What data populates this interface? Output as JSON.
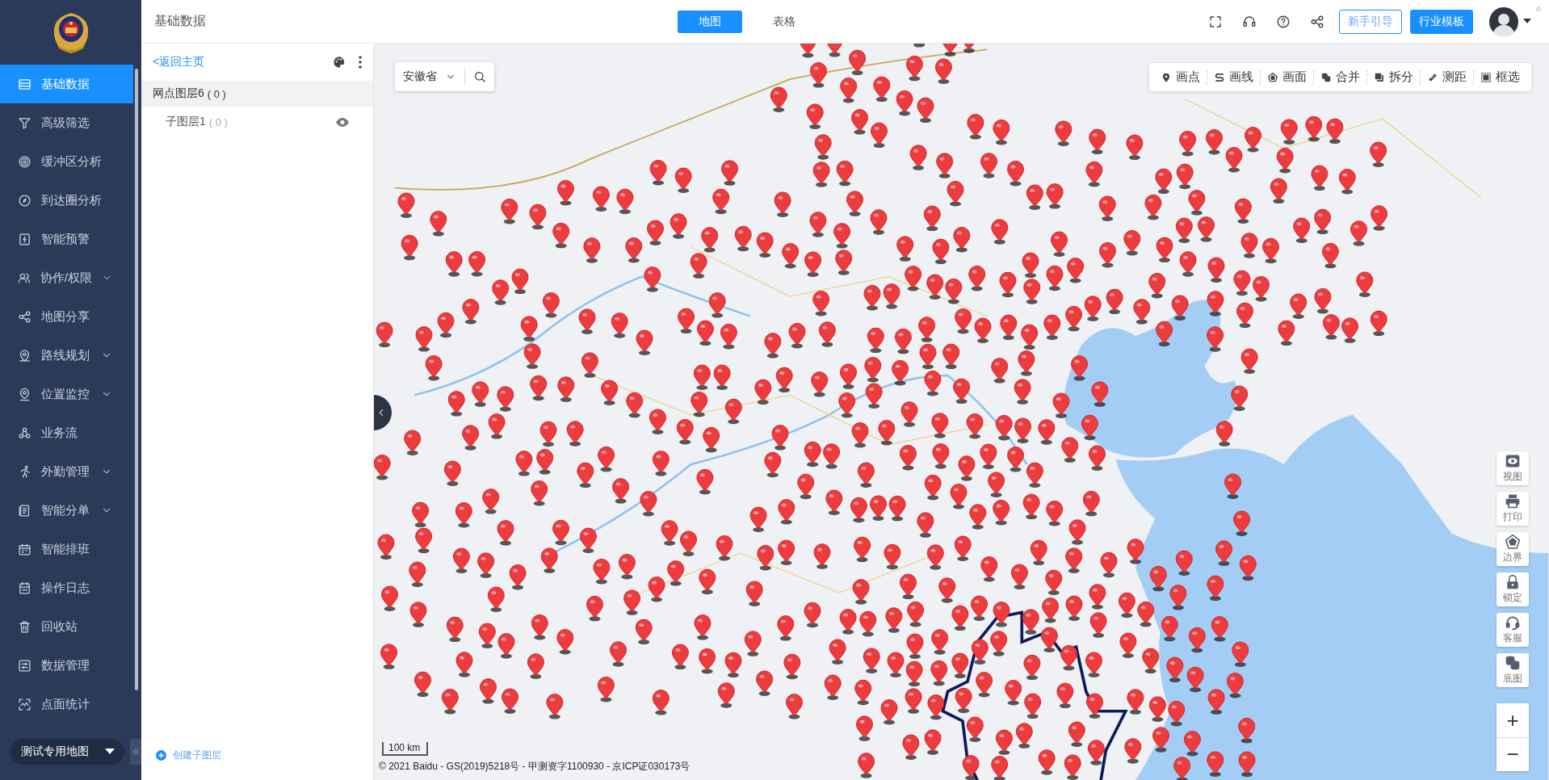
{
  "sidebar": {
    "menu": [
      {
        "label": "基础数据",
        "selected": true,
        "expandable": false
      },
      {
        "label": "高级筛选",
        "selected": false,
        "expandable": false
      },
      {
        "label": "缓冲区分析",
        "selected": false,
        "expandable": false
      },
      {
        "label": "到达圈分析",
        "selected": false,
        "expandable": false
      },
      {
        "label": "智能预警",
        "selected": false,
        "expandable": false
      },
      {
        "label": "协作/权限",
        "selected": false,
        "expandable": true
      },
      {
        "label": "地图分享",
        "selected": false,
        "expandable": false
      },
      {
        "label": "路线规划",
        "selected": false,
        "expandable": true
      },
      {
        "label": "位置监控",
        "selected": false,
        "expandable": true
      },
      {
        "label": "业务流",
        "selected": false,
        "expandable": false
      },
      {
        "label": "外勤管理",
        "selected": false,
        "expandable": true
      },
      {
        "label": "智能分单",
        "selected": false,
        "expandable": true
      },
      {
        "label": "智能排班",
        "selected": false,
        "expandable": false
      },
      {
        "label": "操作日志",
        "selected": false,
        "expandable": false
      },
      {
        "label": "回收站",
        "selected": false,
        "expandable": false
      },
      {
        "label": "数据管理",
        "selected": false,
        "expandable": false
      },
      {
        "label": "点面统计",
        "selected": false,
        "expandable": false
      }
    ],
    "map_selector": "测试专用地图"
  },
  "header": {
    "title": "基础数据",
    "view_tabs": [
      {
        "label": "地图",
        "selected": true
      },
      {
        "label": "表格",
        "selected": false
      }
    ],
    "buttons": [
      {
        "label": "新手引导",
        "kind": "outline"
      },
      {
        "label": "行业模板",
        "kind": "primary"
      }
    ]
  },
  "layer_panel": {
    "back_link": "<返回主页",
    "layers": [
      {
        "name": "网点图层6",
        "count": "( 0 )",
        "selected": true,
        "children": [
          {
            "name": "子图层1",
            "count": "( 0 )",
            "selected": false,
            "visible": true
          }
        ]
      }
    ],
    "create_button": "创建子图层"
  },
  "map": {
    "region_select": "安徽省",
    "draw_tools": [
      "画点",
      "画线",
      "画面",
      "合并",
      "拆分",
      "测距",
      "框选"
    ],
    "side_tools": [
      "视图",
      "打印",
      "边界",
      "锁定",
      "客服",
      "底图"
    ],
    "zoom_buttons": [
      "+",
      "−"
    ],
    "scale": "100 km",
    "copyright": "© 2021 Baidu - GS(2019)5218号 - 甲测资字1100930 - 京ICP证030173号"
  }
}
